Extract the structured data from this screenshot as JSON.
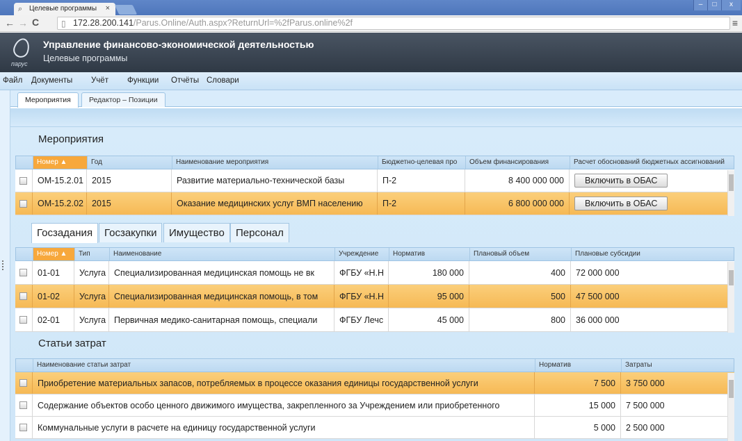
{
  "browser": {
    "tab_title": "Целевые программы",
    "tab_close": "×",
    "url_host": "172.28.200.141",
    "url_path": "/Parus.Online/Auth.aspx?ReturnUrl=%2fParus.online%2f",
    "window_controls": [
      "–",
      "□",
      "x"
    ]
  },
  "app": {
    "logo_text": "парус",
    "title": "Управление финансово-экономической деятельностью",
    "subtitle": "Целевые программы"
  },
  "menu": [
    "Файл",
    "Документы",
    "Учёт",
    "Функции",
    "Отчёты",
    "Словари"
  ],
  "page_tabs": [
    "Мероприятия",
    "Редактор – Позиции"
  ],
  "events": {
    "title": "Мероприятия",
    "columns": [
      "Номер ▲",
      "Год",
      "Наименование мероприятия",
      "Бюджетно-целевая про",
      "Объем финансирования",
      "Расчет обоснований бюджетных ассигнований"
    ],
    "rows": [
      {
        "number": "ОМ-15.2.01",
        "year": "2015",
        "name": "Развитие материально-технической базы",
        "program": "П-2",
        "amount": "8 400 000 000",
        "action": "Включить в ОБАС",
        "selected": false
      },
      {
        "number": "ОМ-15.2.02",
        "year": "2015",
        "name": "Оказание медицинских услуг ВМП населению",
        "program": "П-2",
        "amount": "6 800 000 000",
        "action": "Включить в ОБАС",
        "selected": true
      }
    ]
  },
  "sub_tabs": [
    "Госзадания",
    "Госзакупки",
    "Имущество",
    "Персонал"
  ],
  "tasks": {
    "columns": [
      "Номер ▲",
      "Тип",
      "Наименование",
      "Учреждение",
      "Норматив",
      "Плановый объем",
      "Плановые субсидии"
    ],
    "rows": [
      {
        "number": "01-01",
        "type": "Услуга",
        "name": "Специализированная медицинская помощь не вк",
        "org": "ФГБУ «Н.Н",
        "norm": "180 000",
        "volume": "400",
        "subsidy": "72 000 000",
        "selected": false
      },
      {
        "number": "01-02",
        "type": "Услуга",
        "name": "Специализированная медицинская помощь, в том",
        "org": "ФГБУ «Н.Н",
        "norm": "95 000",
        "volume": "500",
        "subsidy": "47 500 000",
        "selected": true
      },
      {
        "number": "02-01",
        "type": "Услуга",
        "name": "Первичная медико-санитарная помощь, специали",
        "org": "ФГБУ Лечс",
        "norm": "45 000",
        "volume": "800",
        "subsidy": "36 000 000",
        "selected": false
      }
    ]
  },
  "costs": {
    "title": "Статьи затрат",
    "columns": [
      "Наименование статьи затрат",
      "Норматив",
      "Затраты"
    ],
    "rows": [
      {
        "name": "Приобретение материальных запасов, потребляемых в процессе оказания единицы государственной услуги",
        "norm": "7 500",
        "cost": "3 750 000",
        "selected": true
      },
      {
        "name": "Содержание объектов особо ценного движимого имущества, закрепленного за Учреждением или приобретенного",
        "norm": "15 000",
        "cost": "7 500 000",
        "selected": false
      },
      {
        "name": "Коммунальные услуги в расчете на единицу государственной услуги",
        "norm": "5 000",
        "cost": "2 500 000",
        "selected": false
      }
    ]
  }
}
